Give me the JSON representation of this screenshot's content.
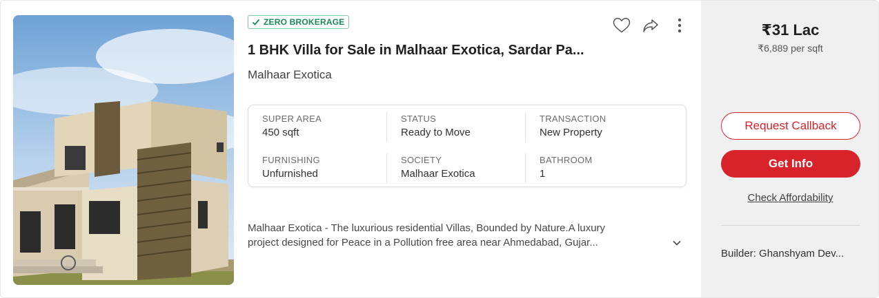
{
  "badge": {
    "label": "ZERO BROKERAGE",
    "icon": "check-icon"
  },
  "listing": {
    "title": "1 BHK Villa for Sale in Malhaar Exotica, Sardar Pa...",
    "project": "Malhaar Exotica",
    "image_icon": "property-photo"
  },
  "actions": {
    "icons": [
      "heart-icon",
      "share-icon",
      "more-vertical-icon"
    ]
  },
  "summary": [
    {
      "label": "SUPER AREA",
      "value": "450 sqft"
    },
    {
      "label": "STATUS",
      "value": "Ready to Move"
    },
    {
      "label": "TRANSACTION",
      "value": "New Property"
    },
    {
      "label": "FURNISHING",
      "value": "Unfurnished"
    },
    {
      "label": "SOCIETY",
      "value": "Malhaar Exotica"
    },
    {
      "label": "BATHROOM",
      "value": "1"
    }
  ],
  "description": {
    "line1": "Malhaar Exotica - The luxurious residential Villas, Bounded by Nature.A luxury",
    "line2": "project designed for Peace in a Pollution free area near Ahmedabad, Gujar...",
    "expand_icon": "chevron-down-icon"
  },
  "pricing": {
    "price": "₹31 Lac",
    "per_sqft": "₹6,889 per sqft"
  },
  "cta": {
    "callback": "Request Callback",
    "info": "Get Info",
    "affordability": "Check Affordability"
  },
  "builder": "Builder: Ghanshyam Dev...",
  "colors": {
    "accent": "#d8232a",
    "badge": "#168a56",
    "side_bg": "#f0f0f0"
  }
}
